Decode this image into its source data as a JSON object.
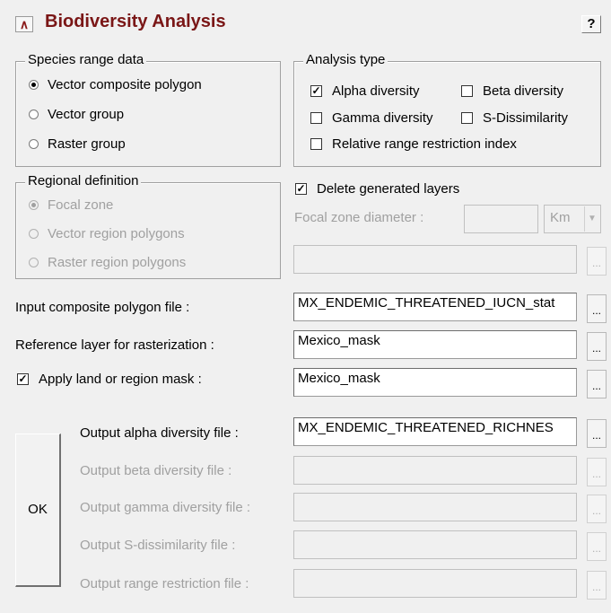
{
  "header": {
    "title": "Biodiversity Analysis",
    "help_label": "?",
    "collapse_icon": "double-chevron-up-icon"
  },
  "species_range": {
    "legend": "Species range data",
    "options": [
      "Vector composite polygon",
      "Vector group",
      "Raster group"
    ],
    "selected": "Vector composite polygon"
  },
  "analysis_type": {
    "legend": "Analysis type",
    "alpha": "Alpha diversity",
    "alpha_checked": true,
    "beta": "Beta diversity",
    "beta_checked": false,
    "gamma": "Gamma diversity",
    "gamma_checked": false,
    "sdis": "S-Dissimilarity",
    "sdis_checked": false,
    "rrri": "Relative range restriction index",
    "rrri_checked": false
  },
  "regional": {
    "legend": "Regional definition",
    "options": [
      "Focal zone",
      "Vector region polygons",
      "Raster region polygons"
    ],
    "selected": "Focal zone"
  },
  "delete_layers": {
    "label": "Delete generated layers",
    "checked": true
  },
  "focal_zone": {
    "label": "Focal zone diameter :",
    "value": "",
    "unit": "Km"
  },
  "inputs": {
    "composite_label": "Input composite polygon file :",
    "composite_value": "MX_ENDEMIC_THREATENED_IUCN_stat",
    "reference_label": "Reference layer for rasterization :",
    "reference_value": "Mexico_mask",
    "mask_label": "Apply land or region mask :",
    "mask_checked": true,
    "mask_value": "Mexico_mask"
  },
  "outputs": {
    "alpha_label": "Output alpha diversity file :",
    "alpha_value": "MX_ENDEMIC_THREATENED_RICHNES",
    "beta_label": "Output beta diversity file :",
    "gamma_label": "Output gamma diversity file :",
    "sdis_label": "Output S-dissimilarity file :",
    "range_label": "Output range restriction file :"
  },
  "ok_label": "OK",
  "browse_label": "..."
}
